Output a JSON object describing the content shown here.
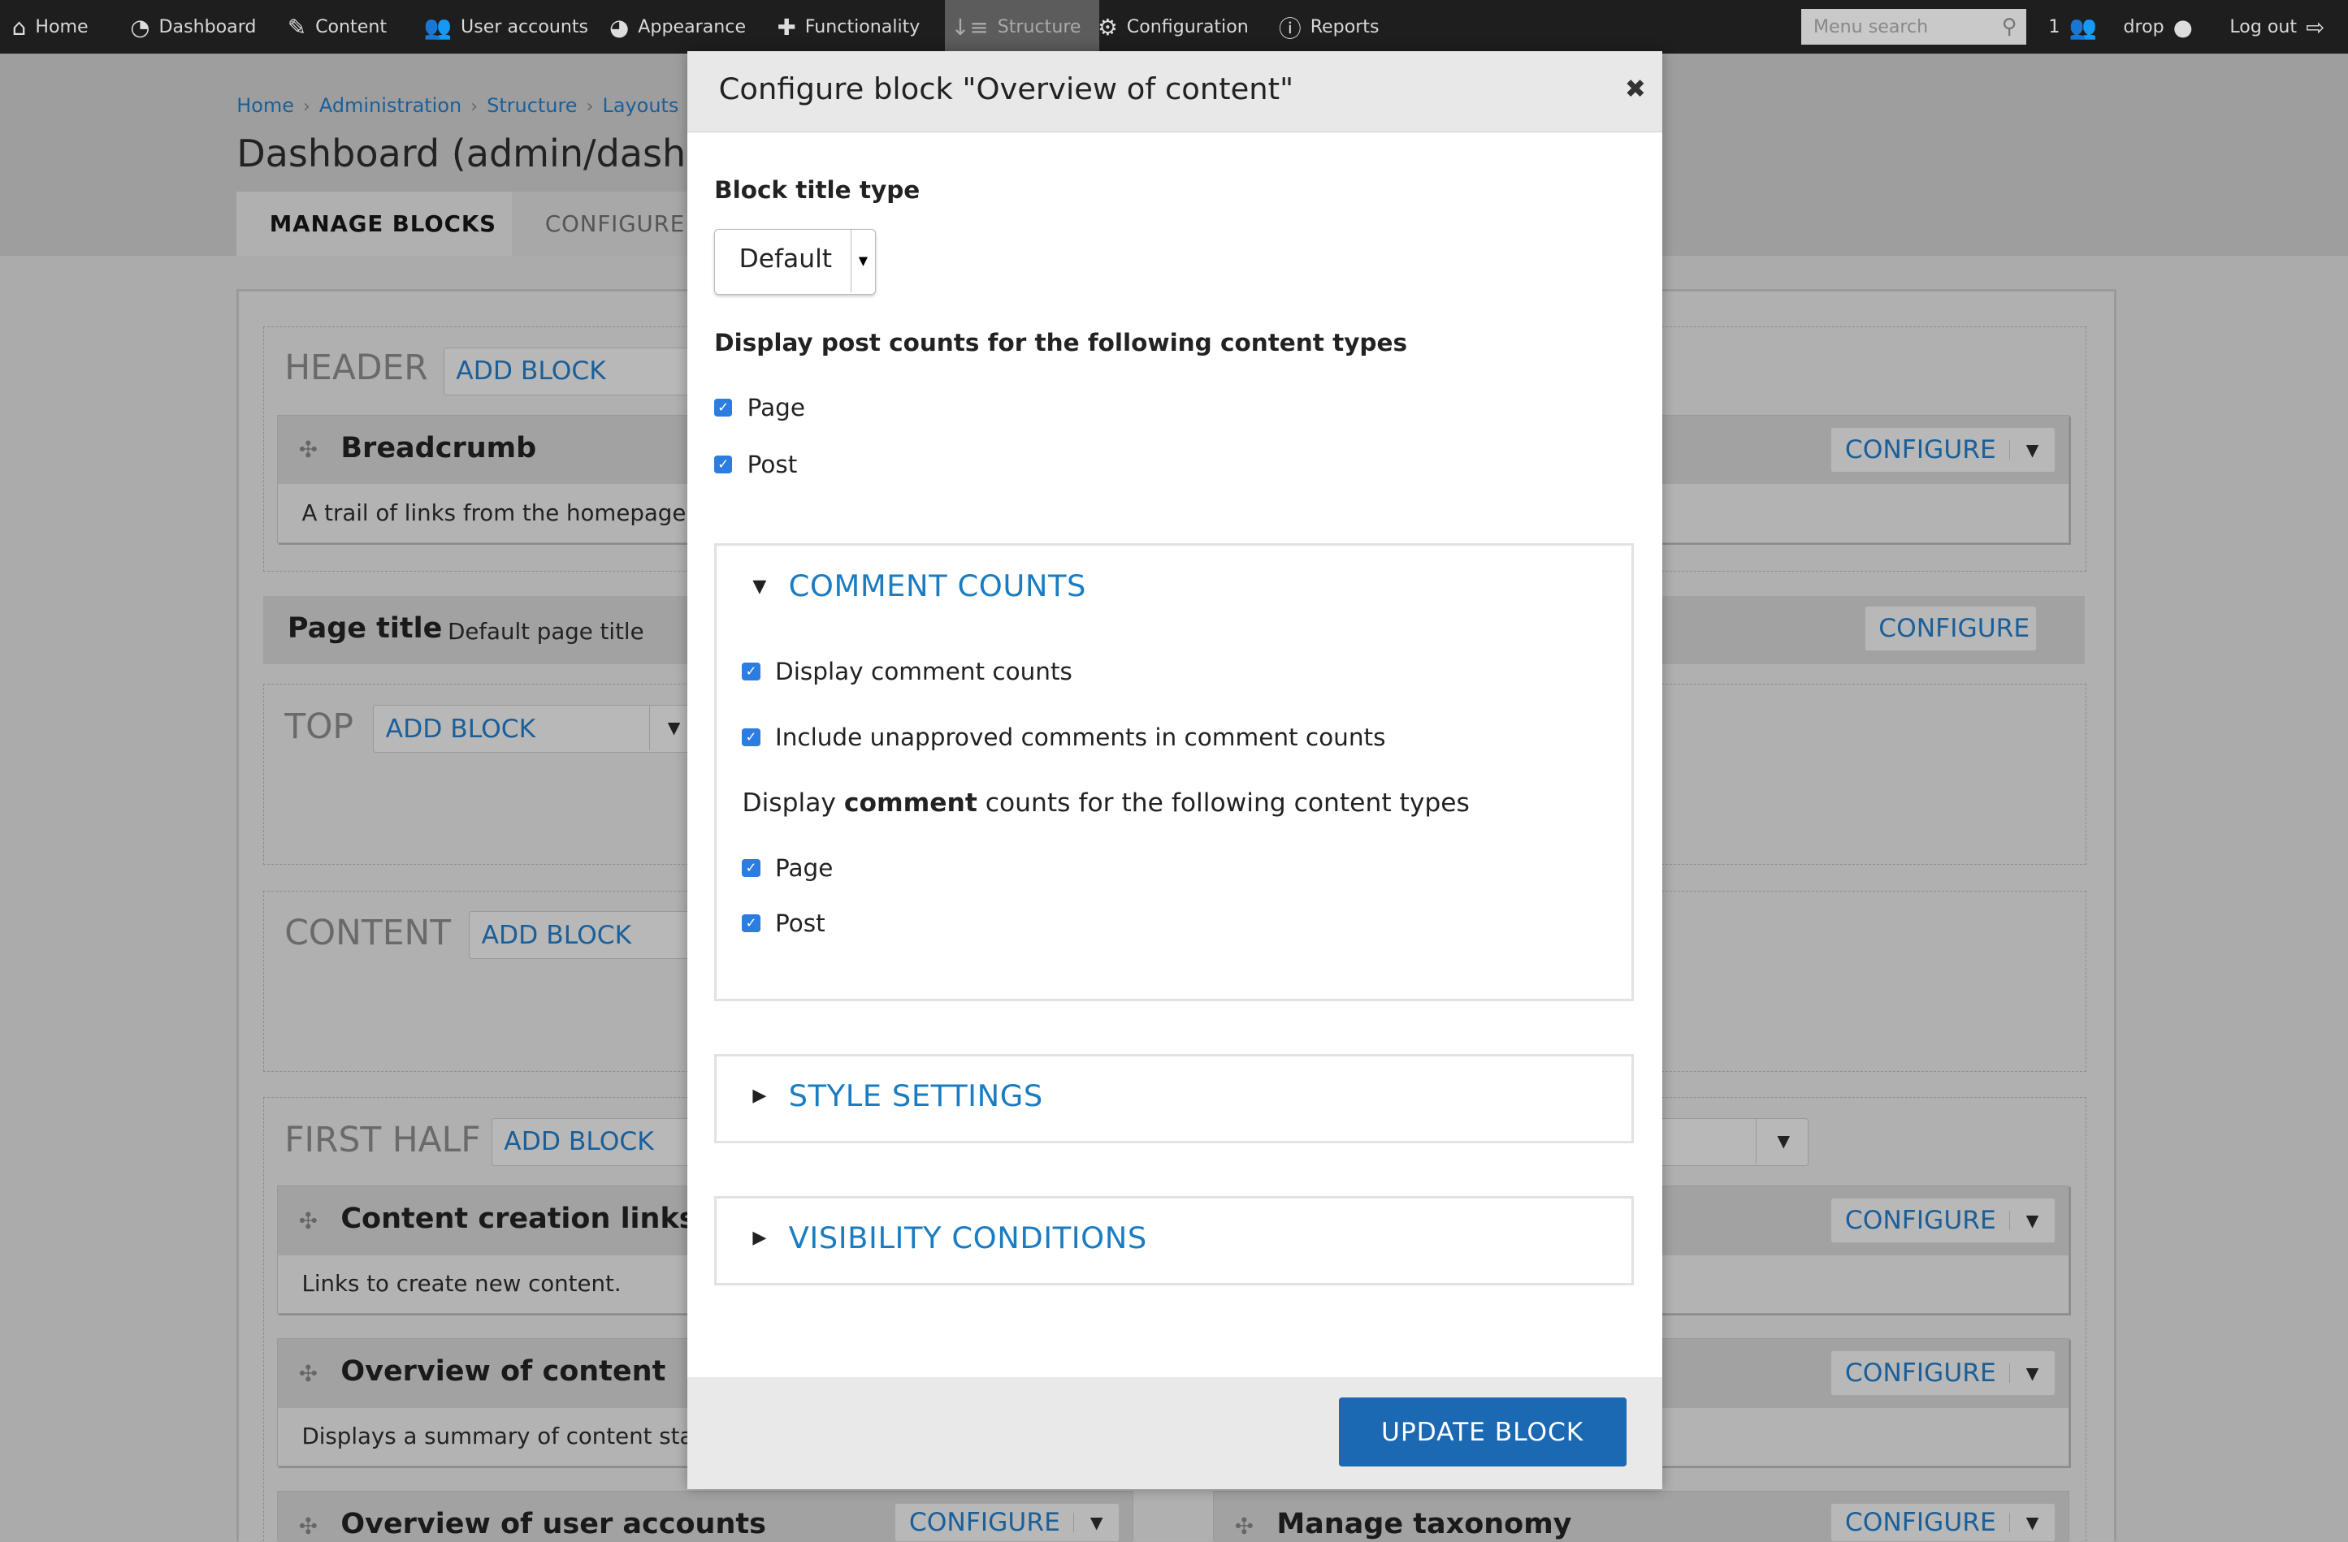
{
  "toolbar": {
    "items": [
      {
        "label": "Home",
        "icon": "home-icon"
      },
      {
        "label": "Dashboard",
        "icon": "dashboard-icon"
      },
      {
        "label": "Content",
        "icon": "pencil-icon"
      },
      {
        "label": "User accounts",
        "icon": "users-icon"
      },
      {
        "label": "Appearance",
        "icon": "palette-icon"
      },
      {
        "label": "Functionality",
        "icon": "puzzle-icon"
      },
      {
        "label": "Structure",
        "icon": "structure-icon"
      },
      {
        "label": "Configuration",
        "icon": "gear-icon"
      },
      {
        "label": "Reports",
        "icon": "info-icon"
      }
    ],
    "search_placeholder": "Menu search",
    "user_count": "1",
    "username": "drop",
    "logout": "Log out"
  },
  "breadcrumb": [
    "Home",
    "Administration",
    "Structure",
    "Layouts"
  ],
  "page_title": "Dashboard (admin/dashbo",
  "tabs": [
    "MANAGE BLOCKS",
    "CONFIGURE"
  ],
  "regions": {
    "header": "HEADER",
    "top": "TOP",
    "content": "CONTENT",
    "first_half": "FIRST HALF",
    "add_block": "ADD BLOCK"
  },
  "blocks": {
    "breadcrumb": {
      "title": "Breadcrumb",
      "desc": "A trail of links from the homepage t"
    },
    "page_title": {
      "title": "Page title",
      "desc": "Default page title"
    },
    "content_links": {
      "title": "Content creation links",
      "desc": "Links to create new content."
    },
    "overview": {
      "title": "Overview of content",
      "desc": "Displays a summary of content stat"
    },
    "users": {
      "title": "Overview of user accounts"
    },
    "taxonomy": {
      "title": "Manage taxonomy"
    },
    "configure": "CONFIGURE"
  },
  "modal": {
    "title": "Configure block \"Overview of content\"",
    "block_title_type_label": "Block title type",
    "block_title_type_value": "Default",
    "post_counts_label": "Display post counts for the following content types",
    "post_types": [
      {
        "label": "Page",
        "checked": true
      },
      {
        "label": "Post",
        "checked": true
      }
    ],
    "comment_counts": {
      "title": "COMMENT COUNTS",
      "expanded": true,
      "display": "Display comment counts",
      "unapproved": "Include unapproved comments in comment counts",
      "types_prefix": "Display ",
      "types_bold": "comment",
      "types_suffix": " counts for the following content types",
      "types": [
        {
          "label": "Page",
          "checked": true
        },
        {
          "label": "Post",
          "checked": true
        }
      ]
    },
    "style_settings": "STYLE SETTINGS",
    "visibility_conditions": "VISIBILITY CONDITIONS",
    "update_button": "UPDATE BLOCK"
  },
  "colors": {
    "toolbar": "#1e1e1e",
    "link": "#1a7cc1",
    "primary_button": "#1b68b3",
    "checkbox": "#2b7de1"
  }
}
